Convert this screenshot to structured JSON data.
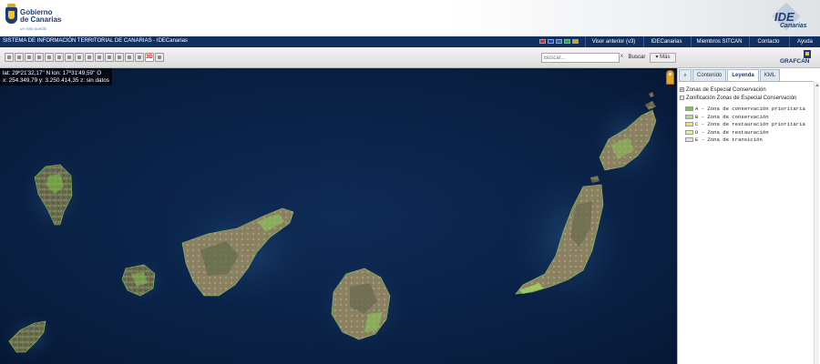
{
  "header": {
    "org_line1": "Gobierno",
    "org_line2": "de Canarias",
    "motto": "un solo pueblo",
    "ide_title": "IDE",
    "ide_subtitle": "Canarias"
  },
  "navbar": {
    "title": "SISTEMA DE INFORMACIÓN TERRITORIAL DE CANARIAS - IDECanarias",
    "buttons": [
      "Visor anterior (v3)",
      "IDECanarias",
      "Miembros SITCAN",
      "Contacto",
      "Ayuda"
    ],
    "flags": [
      {
        "name": "es-flag-icon",
        "color": "#d8262a"
      },
      {
        "name": "gb-flag-icon",
        "color": "#2c4c98"
      },
      {
        "name": "fr-flag-icon",
        "color": "#3b5fb0"
      },
      {
        "name": "it-flag-icon",
        "color": "#39a04a"
      },
      {
        "name": "de-flag-icon",
        "color": "#d4a017"
      }
    ]
  },
  "toolbar": {
    "tools": [
      "pan-icon",
      "zoom-in-icon",
      "zoom-out-icon",
      "info-icon",
      "measure-icon",
      "area-icon",
      "draw-icon",
      "edit-icon",
      "profile-icon",
      "print-icon",
      "layers-icon",
      "table-icon",
      "link-icon",
      "export-icon",
      "3d-icon",
      "grid-icon"
    ],
    "tool_3d_label": "3D",
    "search_placeholder": "Buscar...",
    "search_clear": "x",
    "search_button": "Buscar",
    "more_button": "Más"
  },
  "map": {
    "coords_line1": "lat: 29º21'32,17'' N  lon: 17º31'49,59'' O",
    "coords_line2": "x: 254.349,79  y: 3.250.414,35  z: sin datos"
  },
  "panel": {
    "brand": "GRAFCAN",
    "tabs": [
      "Contenido",
      "Leyenda",
      "KML"
    ],
    "active_tab": "Leyenda",
    "layers": [
      {
        "expander": "+",
        "label": "Zonas de Especial Conservación"
      },
      {
        "expander": "−",
        "label": "Zonificación Zonas de Especial Conservación"
      }
    ],
    "classes": [
      {
        "label": "A - Zona de conservación prioritaria",
        "color": "#7fc35b"
      },
      {
        "label": "B - Zona de conservación",
        "color": "#a8e27a"
      },
      {
        "label": "C - Zona de restauración prioritaria",
        "color": "#f3ea3c"
      },
      {
        "label": "D - Zona de restauración",
        "color": "#d8f7a6"
      },
      {
        "label": "E - Zona de transición",
        "color": "#e4e4e4"
      }
    ]
  }
}
